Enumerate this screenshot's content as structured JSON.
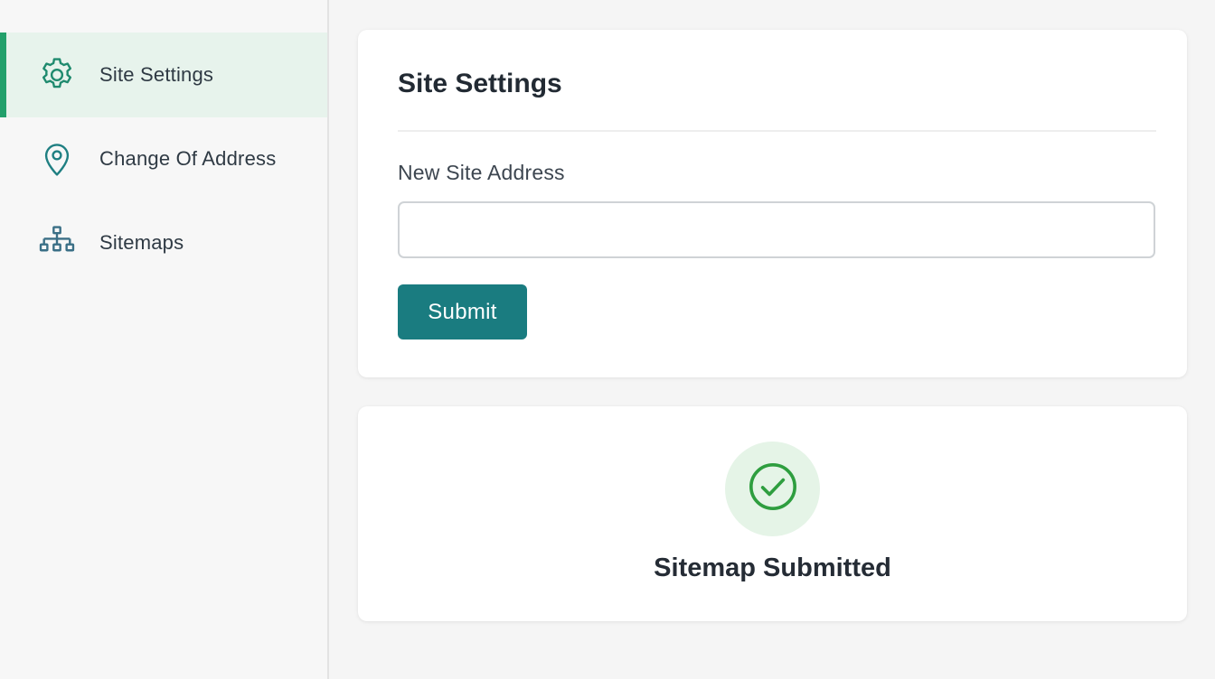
{
  "sidebar": {
    "items": [
      {
        "label": "Site Settings",
        "icon": "gear-icon",
        "active": true
      },
      {
        "label": "Change Of Address",
        "icon": "map-pin-icon",
        "active": false
      },
      {
        "label": "Sitemaps",
        "icon": "sitemap-icon",
        "active": false
      }
    ]
  },
  "settings": {
    "title": "Site Settings",
    "field_label": "New Site Address",
    "input_value": "",
    "submit_label": "Submit"
  },
  "status": {
    "icon": "check-circle-icon",
    "message": "Sitemap Submitted"
  },
  "colors": {
    "accent": "#22a06b",
    "active_bg": "#e7f3ec",
    "button": "#1a7c80",
    "success": "#2e9e3f",
    "success_bg": "#e5f4e7"
  }
}
